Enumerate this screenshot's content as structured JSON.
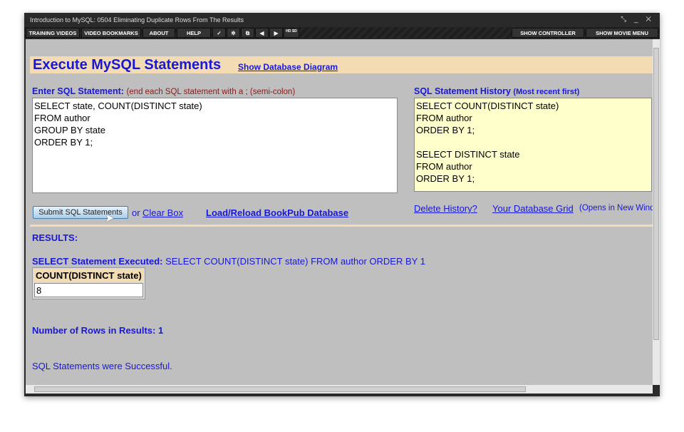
{
  "window": {
    "title": "Introduction to MySQL: 0504 Eliminating Duplicate Rows From The Results"
  },
  "toolbar": {
    "items": [
      "TRAINING VIDEOS",
      "VIDEO BOOKMARKS",
      "ABOUT",
      "HELP"
    ],
    "show_controller": "SHOW CONTROLLER",
    "show_movie_menu": "SHOW MOVIE MENU",
    "hd_sd": "HD SD"
  },
  "page": {
    "title": "Execute MySQL Statements",
    "diagram_link": "Show Database Diagram",
    "enter_label": "Enter SQL Statement:",
    "enter_hint": "(end each SQL statement with a ; (semi-colon)",
    "sql_input": "SELECT state, COUNT(DISTINCT state)\nFROM author\nGROUP BY state\nORDER BY 1;",
    "history_label": "SQL Statement History",
    "history_hint": "(Most recent first)",
    "history": "SELECT COUNT(DISTINCT state)\nFROM author\nORDER BY 1;\n\nSELECT DISTINCT state\nFROM author\nORDER BY 1;",
    "submit": "Submit SQL Statements",
    "or": "or",
    "clear": "Clear Box",
    "load": "Load/Reload BookPub Database",
    "delete_history": "Delete History?",
    "db_grid": "Your Database Grid",
    "db_grid_hint": "(Opens in New Windo",
    "results": "RESULTS:",
    "executed_label": "SELECT Statement Executed:",
    "executed_sql": "SELECT COUNT(DISTINCT state) FROM author ORDER BY 1",
    "table": {
      "headers": [
        "COUNT(DISTINCT state)"
      ],
      "rows": [
        [
          "8"
        ]
      ]
    },
    "rows_count": "Number of Rows in Results: 1",
    "success": "SQL Statements were Successful."
  }
}
